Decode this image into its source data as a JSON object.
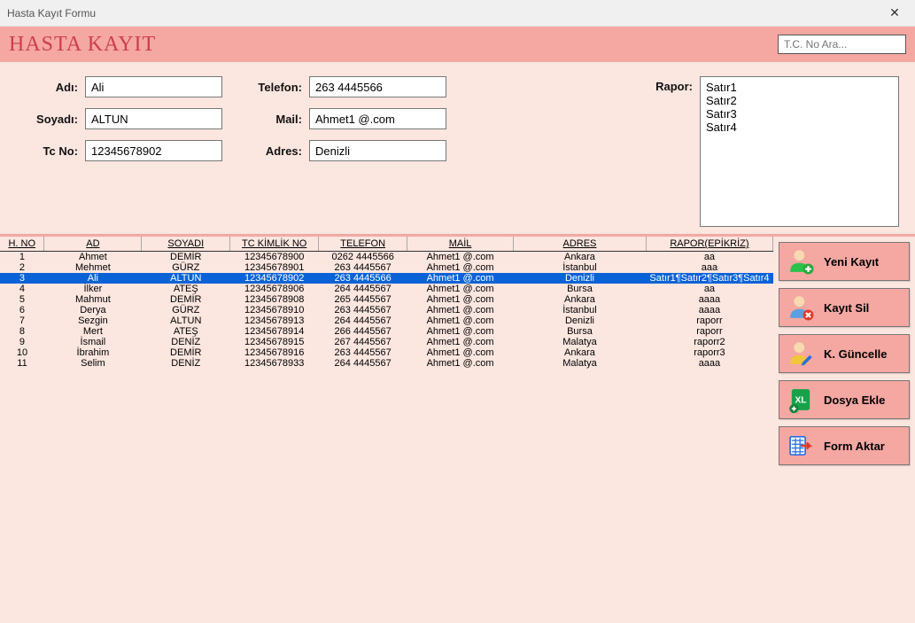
{
  "window": {
    "title": "Hasta Kayıt Formu"
  },
  "header": {
    "title": "HASTA KAYIT"
  },
  "search": {
    "placeholder": "T.C. No Ara..."
  },
  "form": {
    "labels": {
      "adi": "Adı:",
      "soyadi": "Soyadı:",
      "tcno": "Tc No:",
      "telefon": "Telefon:",
      "mail": "Mail:",
      "adres": "Adres:",
      "rapor": "Rapor:"
    },
    "values": {
      "adi": "Ali",
      "soyadi": "ALTUN",
      "tcno": "12345678902",
      "telefon": "263 4445566",
      "mail": "Ahmet1 @.com",
      "adres": "Denizli",
      "rapor": "Satır1\nSatır2\nSatır3\nSatır4"
    }
  },
  "grid": {
    "headers": {
      "no": "H. NO",
      "ad": "AD",
      "soyadi": "SOYADI",
      "tc": "TC KİMLİK NO",
      "tel": "TELEFON",
      "mail": "MAİL",
      "adres": "ADRES",
      "rapor": "RAPOR(EPİKRİZ)"
    },
    "selected_index": 2,
    "rows": [
      {
        "no": "1",
        "ad": "Ahmet",
        "soyadi": "DEMİR",
        "tc": "12345678900",
        "tel": "0262 4445566",
        "mail": "Ahmet1 @.com",
        "adres": "Ankara",
        "rapor": "aa"
      },
      {
        "no": "2",
        "ad": "Mehmet",
        "soyadi": "GÜRZ",
        "tc": "12345678901",
        "tel": "263 4445567",
        "mail": "Ahmet1 @.com",
        "adres": "İstanbul",
        "rapor": "aaa"
      },
      {
        "no": "3",
        "ad": "Ali",
        "soyadi": "ALTUN",
        "tc": "12345678902",
        "tel": "263 4445566",
        "mail": "Ahmet1 @.com",
        "adres": "Denizli",
        "rapor": "Satır1¶Satır2¶Satır3¶Satır4"
      },
      {
        "no": "4",
        "ad": "İlker",
        "soyadi": "ATEŞ",
        "tc": "12345678906",
        "tel": "264 4445567",
        "mail": "Ahmet1 @.com",
        "adres": "Bursa",
        "rapor": "aa"
      },
      {
        "no": "5",
        "ad": "Mahmut",
        "soyadi": "DEMİR",
        "tc": "12345678908",
        "tel": "265 4445567",
        "mail": "Ahmet1 @.com",
        "adres": "Ankara",
        "rapor": "aaaa"
      },
      {
        "no": "6",
        "ad": "Derya",
        "soyadi": "GÜRZ",
        "tc": "12345678910",
        "tel": "263 4445567",
        "mail": "Ahmet1 @.com",
        "adres": "İstanbul",
        "rapor": "aaaa"
      },
      {
        "no": "7",
        "ad": "Sezgin",
        "soyadi": "ALTUN",
        "tc": "12345678913",
        "tel": "264 4445567",
        "mail": "Ahmet1 @.com",
        "adres": "Denizli",
        "rapor": "raporr"
      },
      {
        "no": "8",
        "ad": "Mert",
        "soyadi": "ATEŞ",
        "tc": "12345678914",
        "tel": "266 4445567",
        "mail": "Ahmet1 @.com",
        "adres": "Bursa",
        "rapor": "raporr"
      },
      {
        "no": "9",
        "ad": "İsmail",
        "soyadi": "DENİZ",
        "tc": "12345678915",
        "tel": "267 4445567",
        "mail": "Ahmet1 @.com",
        "adres": "Malatya",
        "rapor": "raporr2"
      },
      {
        "no": "10",
        "ad": "İbrahim",
        "soyadi": "DEMİR",
        "tc": "12345678916",
        "tel": "263 4445567",
        "mail": "Ahmet1 @.com",
        "adres": "Ankara",
        "rapor": "raporr3"
      },
      {
        "no": "11",
        "ad": "Selim",
        "soyadi": "DENİZ",
        "tc": "12345678933",
        "tel": "264 4445567",
        "mail": "Ahmet1 @.com",
        "adres": "Malatya",
        "rapor": "aaaa"
      }
    ]
  },
  "buttons": {
    "yeni": "Yeni Kayıt",
    "sil": "Kayıt Sil",
    "guncelle": "K. Güncelle",
    "dosya": "Dosya Ekle",
    "aktar": "Form Aktar"
  },
  "colors": {
    "accent": "#f5a7a2",
    "bg": "#fce6e0",
    "headtext": "#cc3e4e",
    "select": "#0a63d6"
  }
}
